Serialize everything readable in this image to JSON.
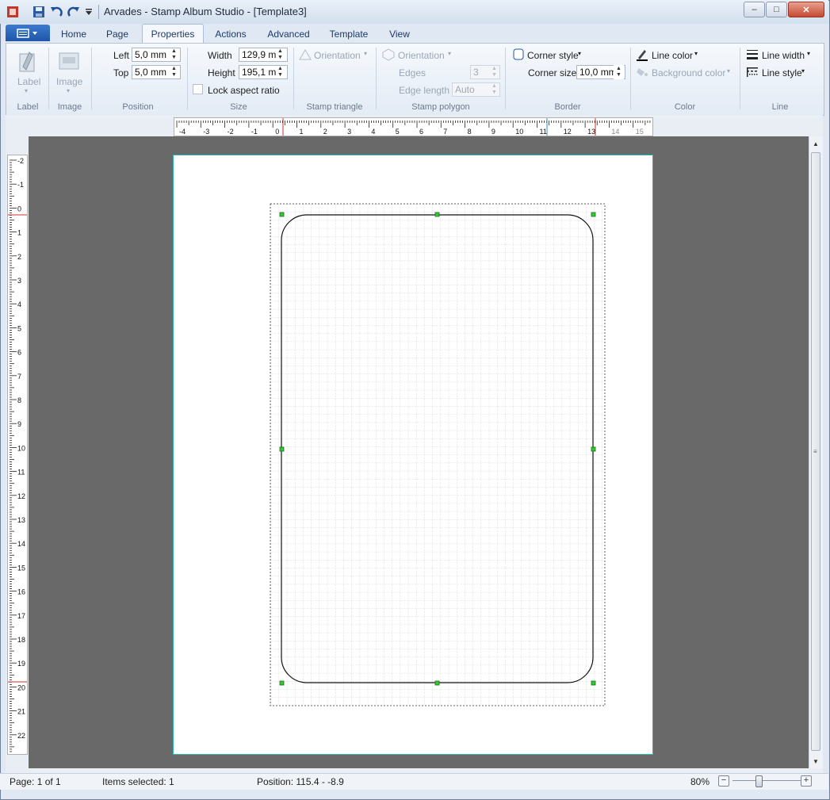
{
  "window": {
    "title": "Arvades - Stamp Album Studio - [Template3]",
    "controls": [
      "–",
      "□",
      "✕"
    ]
  },
  "tabs": [
    "Home",
    "Page",
    "Properties",
    "Actions",
    "Advanced",
    "Template",
    "View"
  ],
  "active_tab": "Properties",
  "ribbon": {
    "label_group": {
      "button": "Label",
      "group": "Label"
    },
    "image_group": {
      "button": "Image",
      "group": "Image"
    },
    "position": {
      "left_label": "Left",
      "left_value": "5,0 mm",
      "top_label": "Top",
      "top_value": "5,0 mm",
      "group": "Position"
    },
    "size": {
      "width_label": "Width",
      "width_value": "129,9 m",
      "height_label": "Height",
      "height_value": "195,1 m",
      "lock_label": "Lock aspect ratio",
      "group": "Size"
    },
    "stamp_triangle": {
      "orientation": "Orientation",
      "group": "Stamp triangle"
    },
    "stamp_polygon": {
      "orientation": "Orientation",
      "edges_label": "Edges",
      "edges_value": "3",
      "edge_length_label": "Edge length",
      "edge_length_value": "Auto",
      "group": "Stamp polygon"
    },
    "border": {
      "corner_style": "Corner style",
      "corner_size_label": "Corner size",
      "corner_size_value": "10,0 mm",
      "group": "Border"
    },
    "color": {
      "line_color": "Line color",
      "background_color": "Background color",
      "group": "Color"
    },
    "line": {
      "line_width": "Line width",
      "line_style": "Line style",
      "group": "Line"
    }
  },
  "rulers": {
    "horizontal_labels": [
      "-4",
      "-3",
      "-2",
      "-1",
      "0",
      "1",
      "2",
      "3",
      "4",
      "5",
      "6",
      "7",
      "8",
      "9",
      "10",
      "11",
      "12",
      "13",
      "14",
      "15"
    ],
    "vertical_labels": [
      "-2",
      "-1",
      "0",
      "1",
      "2",
      "3",
      "4",
      "5",
      "6",
      "7",
      "8",
      "9",
      "10",
      "11",
      "12",
      "13",
      "14",
      "15",
      "16",
      "17",
      "18",
      "19",
      "20",
      "21",
      "22"
    ]
  },
  "status": {
    "page": "Page: 1 of 1",
    "items_selected": "Items selected: 1",
    "position": "Position: 115.4 - -8.9",
    "zoom": "80%"
  },
  "zoom_level": 0.8,
  "colors": {
    "accent": "#1e56a8",
    "page_border": "#26b7b0",
    "canvas": "#696969",
    "handle": "#2ecc2e"
  }
}
